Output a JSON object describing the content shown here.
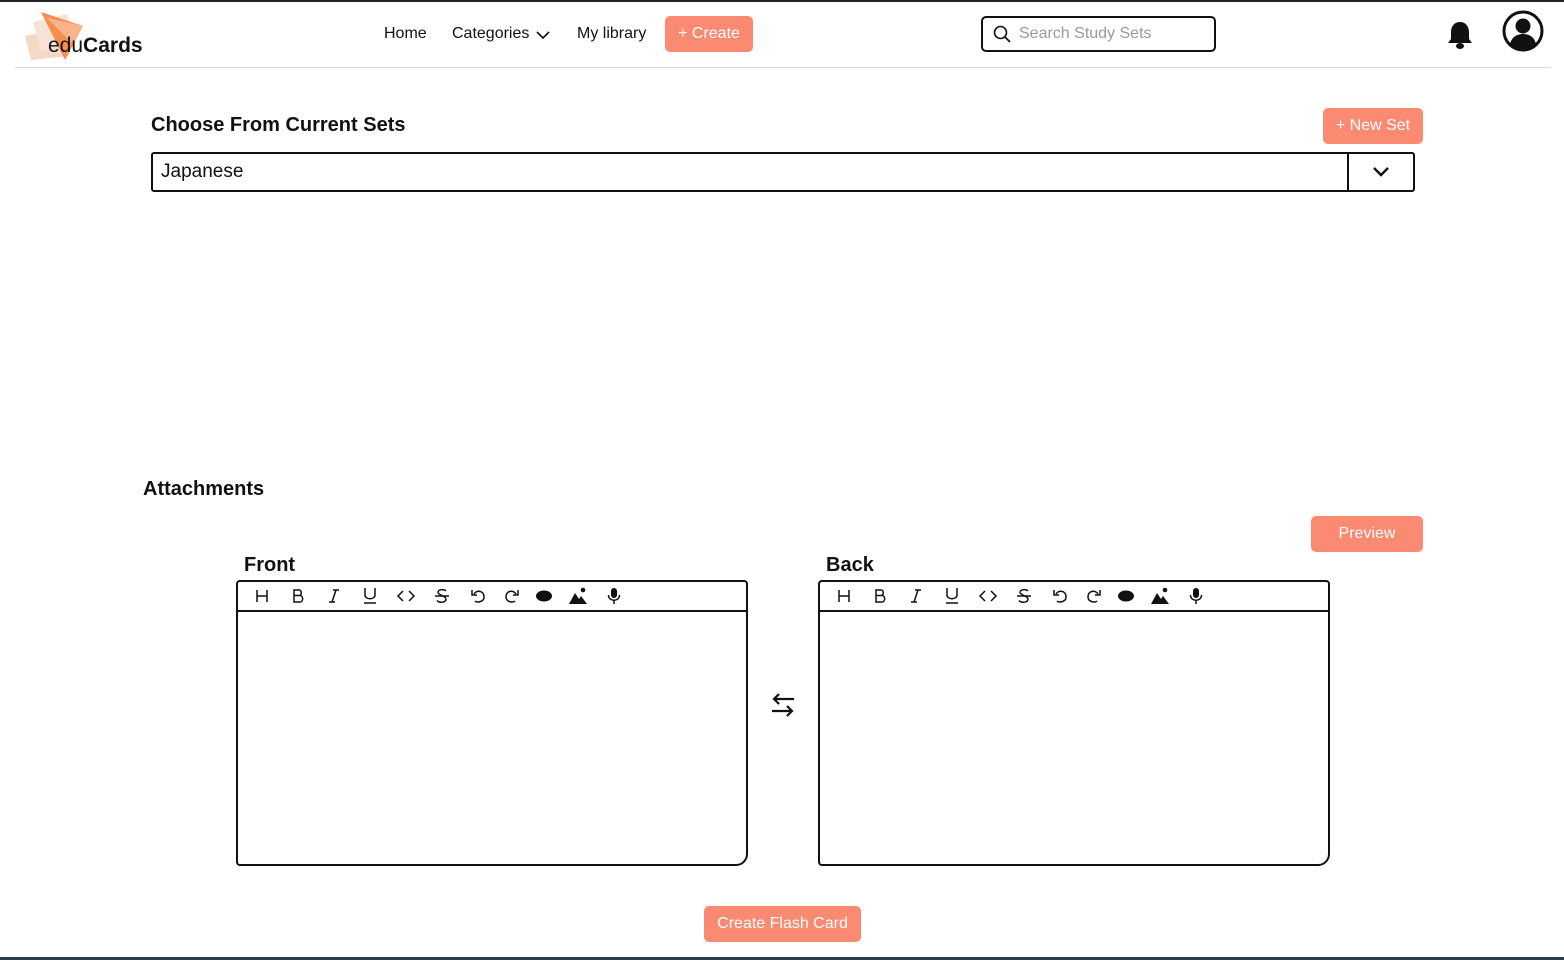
{
  "app": {
    "logo_prefix": "edu",
    "logo_suffix": "Cards"
  },
  "nav": {
    "home": "Home",
    "categories": "Categories",
    "my_library": "My library",
    "create": "+ Create"
  },
  "search": {
    "placeholder": "Search Study Sets",
    "value": ""
  },
  "sets": {
    "title": "Choose From Current Sets",
    "new_set_label": "+ New Set",
    "selected": "Japanese"
  },
  "attachments": {
    "title": "Attachments",
    "preview_label": "Preview"
  },
  "editors": {
    "front_label": "Front",
    "back_label": "Back",
    "toolbar_icons": [
      "heading-icon",
      "bold-icon",
      "italic-icon",
      "underline-icon",
      "code-icon",
      "strikethrough-icon",
      "undo-icon",
      "redo-icon",
      "record-dot-icon",
      "image-icon",
      "microphone-icon"
    ]
  },
  "footer": {
    "create_card_label": "Create Flash Card"
  },
  "colors": {
    "accent": "#fa8a72",
    "logo_orange": "#f7833f",
    "logo_beige": "#f4d9c7"
  }
}
